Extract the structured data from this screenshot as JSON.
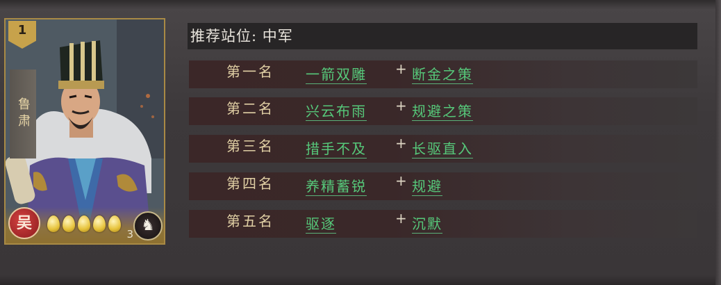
{
  "card": {
    "rank": "1",
    "name": "鲁肃",
    "faction": "吴",
    "cost": "3",
    "cost_pips": 5,
    "unit_icon": "horse-icon"
  },
  "recommendation": {
    "position_label": "推荐站位: 中军",
    "ranks": [
      {
        "label": "第一名",
        "skill_1": "一箭双雕",
        "plus": "+",
        "skill_2": "断金之策"
      },
      {
        "label": "第二名",
        "skill_1": "兴云布雨",
        "plus": "+",
        "skill_2": "规避之策"
      },
      {
        "label": "第三名",
        "skill_1": "措手不及",
        "plus": "+",
        "skill_2": "长驱直入"
      },
      {
        "label": "第四名",
        "skill_1": "养精蓄锐",
        "plus": "+",
        "skill_2": "规避"
      },
      {
        "label": "第五名",
        "skill_1": "驱逐",
        "plus": "+",
        "skill_2": "沉默"
      }
    ]
  },
  "colors": {
    "skill_green": "#56c87a",
    "rank_gold": "#e0cfa4",
    "card_border": "#a98a45"
  }
}
